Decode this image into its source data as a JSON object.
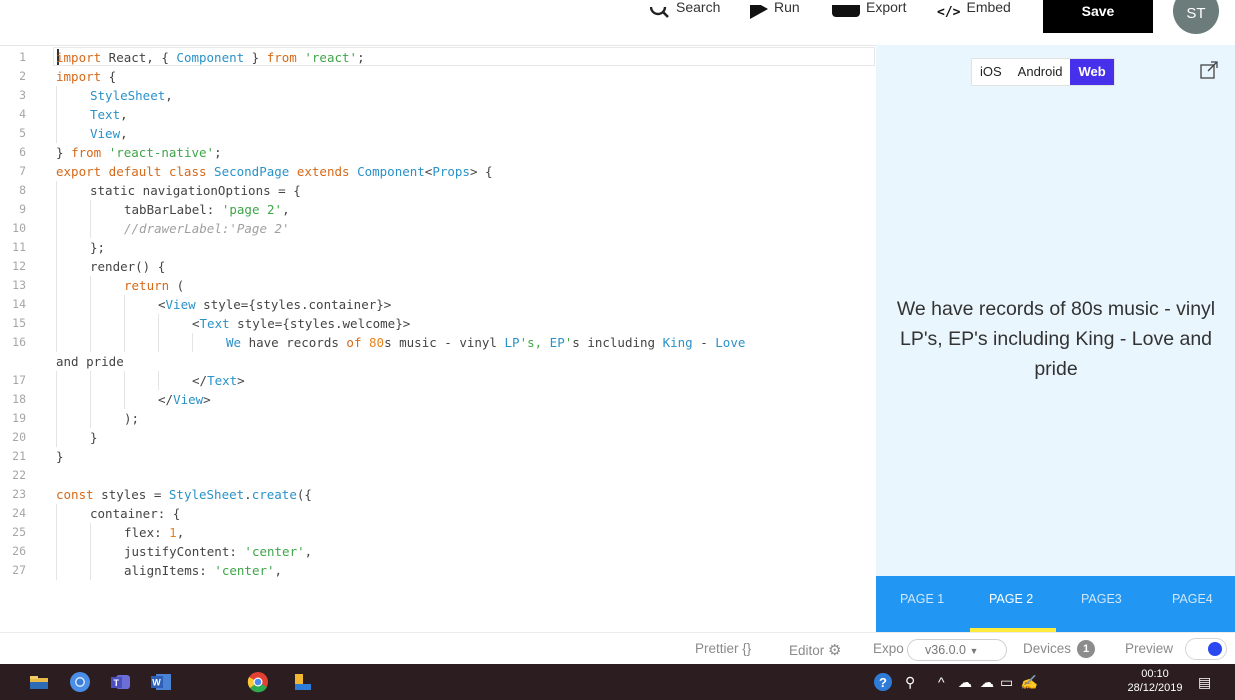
{
  "toolbar": {
    "search_label": "Search",
    "run_label": "Run",
    "export_label": "Export",
    "embed_label": "Embed",
    "save_label": "Save",
    "avatar_initials": "ST"
  },
  "editor": {
    "lines": [
      {
        "n": "1",
        "indent": 0,
        "tokens": [
          [
            "kw",
            "import"
          ],
          [
            "pl",
            " React, { "
          ],
          [
            "typ",
            "Component"
          ],
          [
            "pl",
            " } "
          ],
          [
            "kw",
            "from"
          ],
          [
            "pl",
            " "
          ],
          [
            "str",
            "'react'"
          ],
          [
            "pl",
            ";"
          ]
        ]
      },
      {
        "n": "2",
        "indent": 0,
        "tokens": [
          [
            "kw",
            "import"
          ],
          [
            "pl",
            " {"
          ]
        ]
      },
      {
        "n": "3",
        "indent": 1,
        "tokens": [
          [
            "typ",
            "StyleSheet"
          ],
          [
            "pl",
            ","
          ]
        ]
      },
      {
        "n": "4",
        "indent": 1,
        "tokens": [
          [
            "typ",
            "Text"
          ],
          [
            "pl",
            ","
          ]
        ]
      },
      {
        "n": "5",
        "indent": 1,
        "tokens": [
          [
            "typ",
            "View"
          ],
          [
            "pl",
            ","
          ]
        ]
      },
      {
        "n": "6",
        "indent": 0,
        "tokens": [
          [
            "pl",
            "} "
          ],
          [
            "kw",
            "from"
          ],
          [
            "pl",
            " "
          ],
          [
            "str",
            "'react-native'"
          ],
          [
            "pl",
            ";"
          ]
        ]
      },
      {
        "n": "7",
        "indent": 0,
        "tokens": [
          [
            "kw",
            "export default class"
          ],
          [
            "pl",
            " "
          ],
          [
            "typ",
            "SecondPage"
          ],
          [
            "pl",
            " "
          ],
          [
            "kw",
            "extends"
          ],
          [
            "pl",
            " "
          ],
          [
            "typ",
            "Component"
          ],
          [
            "pl",
            "<"
          ],
          [
            "typ",
            "Props"
          ],
          [
            "pl",
            "> {"
          ]
        ]
      },
      {
        "n": "8",
        "indent": 1,
        "tokens": [
          [
            "pl",
            "static navigationOptions = {"
          ]
        ]
      },
      {
        "n": "9",
        "indent": 2,
        "tokens": [
          [
            "pl",
            "tabBarLabel: "
          ],
          [
            "str",
            "'page 2'"
          ],
          [
            "pl",
            ","
          ]
        ]
      },
      {
        "n": "10",
        "indent": 2,
        "tokens": [
          [
            "cm",
            "//drawerLabel:'Page 2'"
          ]
        ]
      },
      {
        "n": "11",
        "indent": 1,
        "tokens": [
          [
            "pl",
            "};"
          ]
        ]
      },
      {
        "n": "12",
        "indent": 1,
        "tokens": [
          [
            "pl",
            "render() {"
          ]
        ]
      },
      {
        "n": "13",
        "indent": 2,
        "tokens": [
          [
            "kw",
            "return"
          ],
          [
            "pl",
            " ("
          ]
        ]
      },
      {
        "n": "14",
        "indent": 3,
        "tokens": [
          [
            "pl",
            "<"
          ],
          [
            "typ",
            "View"
          ],
          [
            "pl",
            " style={styles.container}>"
          ]
        ]
      },
      {
        "n": "15",
        "indent": 4,
        "tokens": [
          [
            "pl",
            "<"
          ],
          [
            "typ",
            "Text"
          ],
          [
            "pl",
            " style={styles.welcome}>"
          ]
        ]
      },
      {
        "n": "16",
        "indent": 5,
        "tokens": [
          [
            "typ",
            "We"
          ],
          [
            "pl",
            " have records "
          ],
          [
            "kw",
            "of"
          ],
          [
            "pl",
            " "
          ],
          [
            "num",
            "80"
          ],
          [
            "pl",
            "s music - vinyl "
          ],
          [
            "typ",
            "LP"
          ],
          [
            "str",
            "'s, "
          ],
          [
            "typ",
            "EP"
          ],
          [
            "str",
            "'"
          ],
          [
            "pl",
            "s including "
          ],
          [
            "typ",
            "King"
          ],
          [
            "pl",
            " - "
          ],
          [
            "typ",
            "Love"
          ]
        ]
      },
      {
        "n": "",
        "indent": 0,
        "tokens": [
          [
            "pl",
            "and pride"
          ]
        ]
      },
      {
        "n": "17",
        "indent": 4,
        "tokens": [
          [
            "pl",
            "</"
          ],
          [
            "typ",
            "Text"
          ],
          [
            "pl",
            ">"
          ]
        ]
      },
      {
        "n": "18",
        "indent": 3,
        "tokens": [
          [
            "pl",
            "</"
          ],
          [
            "typ",
            "View"
          ],
          [
            "pl",
            ">"
          ]
        ]
      },
      {
        "n": "19",
        "indent": 2,
        "tokens": [
          [
            "pl",
            ");"
          ]
        ]
      },
      {
        "n": "20",
        "indent": 1,
        "tokens": [
          [
            "pl",
            "}"
          ]
        ]
      },
      {
        "n": "21",
        "indent": 0,
        "tokens": [
          [
            "pl",
            "}"
          ]
        ]
      },
      {
        "n": "22",
        "indent": 0,
        "tokens": []
      },
      {
        "n": "23",
        "indent": 0,
        "tokens": [
          [
            "kw",
            "const"
          ],
          [
            "pl",
            " styles = "
          ],
          [
            "typ",
            "StyleSheet"
          ],
          [
            "pl",
            "."
          ],
          [
            "typ",
            "create"
          ],
          [
            "pl",
            "({"
          ]
        ]
      },
      {
        "n": "24",
        "indent": 1,
        "tokens": [
          [
            "pl",
            "container: {"
          ]
        ]
      },
      {
        "n": "25",
        "indent": 2,
        "tokens": [
          [
            "pl",
            "flex: "
          ],
          [
            "num",
            "1"
          ],
          [
            "pl",
            ","
          ]
        ]
      },
      {
        "n": "26",
        "indent": 2,
        "tokens": [
          [
            "pl",
            "justifyContent: "
          ],
          [
            "str",
            "'center'"
          ],
          [
            "pl",
            ","
          ]
        ]
      },
      {
        "n": "27",
        "indent": 2,
        "tokens": [
          [
            "pl",
            "alignItems: "
          ],
          [
            "str",
            "'center'"
          ],
          [
            "pl",
            ","
          ]
        ]
      }
    ]
  },
  "preview": {
    "platforms": [
      "iOS",
      "Android",
      "Web"
    ],
    "active_platform": "Web",
    "message": "We have records of 80s music - vinyl LP's, EP's including King - Love and pride",
    "tabs": [
      "PAGE 1",
      "PAGE 2",
      "PAGE3",
      "PAGE4"
    ],
    "active_tab": "PAGE 2"
  },
  "footer": {
    "prettier_label": "Prettier",
    "prettier_icon": "{}",
    "editor_label": "Editor",
    "expo_label": "Expo",
    "version": "v36.0.0",
    "devices_label": "Devices",
    "devices_count": "1",
    "preview_label": "Preview",
    "preview_enabled": true
  },
  "taskbar": {
    "time": "00:10",
    "date": "28/12/2019"
  },
  "colors": {
    "expo_accent": "#4630eb",
    "tabbar": "#2196f3",
    "tab_indicator": "#ffeb3b",
    "preview_bg": "#eaf6fd"
  }
}
